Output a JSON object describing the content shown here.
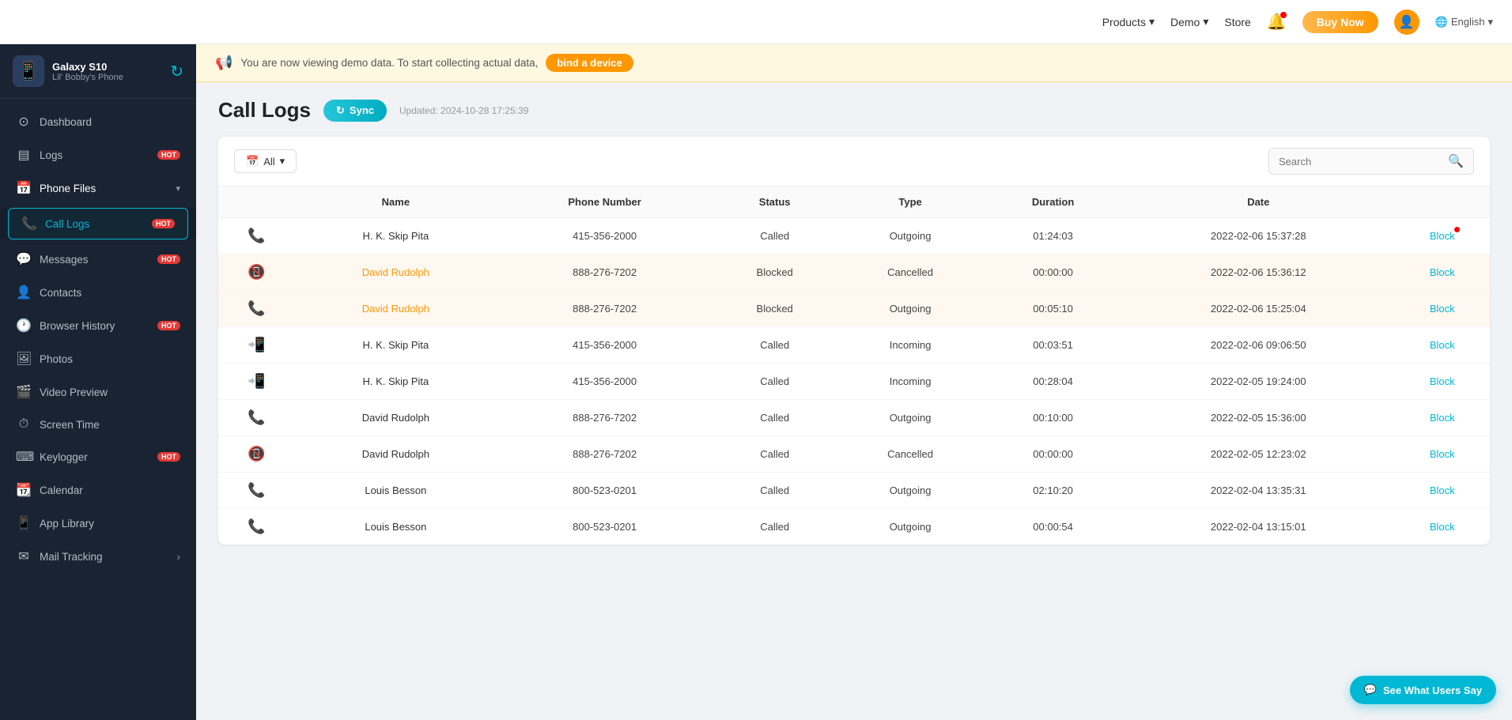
{
  "topnav": {
    "products_label": "Products",
    "demo_label": "Demo",
    "store_label": "Store",
    "buy_now_label": "Buy Now",
    "english_label": "English",
    "chevron": "▾"
  },
  "sidebar": {
    "device_name": "Galaxy S10",
    "device_sub": "Lil' Bobby's Phone",
    "items": [
      {
        "id": "dashboard",
        "label": "Dashboard",
        "icon": "⊙"
      },
      {
        "id": "logs",
        "label": "Logs",
        "icon": "▤",
        "hot": true
      },
      {
        "id": "phone-files",
        "label": "Phone Files",
        "icon": "📅",
        "has_chevron": true,
        "expanded": true
      },
      {
        "id": "call-logs",
        "label": "Call Logs",
        "icon": "📞",
        "hot": true,
        "sub": true,
        "selected": true
      },
      {
        "id": "messages",
        "label": "Messages",
        "icon": "💬",
        "hot": true,
        "sub": false
      },
      {
        "id": "contacts",
        "label": "Contacts",
        "icon": "👤"
      },
      {
        "id": "browser-history",
        "label": "Browser History",
        "icon": "🕐",
        "hot": true
      },
      {
        "id": "photos",
        "label": "Photos",
        "icon": "🖼"
      },
      {
        "id": "video-preview",
        "label": "Video Preview",
        "icon": "🎬"
      },
      {
        "id": "screen-time",
        "label": "Screen Time",
        "icon": "⏱"
      },
      {
        "id": "keylogger",
        "label": "Keylogger",
        "icon": "⌨",
        "hot": true
      },
      {
        "id": "calendar",
        "label": "Calendar",
        "icon": "📆"
      },
      {
        "id": "app-library",
        "label": "App Library",
        "icon": "📱"
      },
      {
        "id": "mail-tracking",
        "label": "Mail Tracking",
        "icon": "✉",
        "has_arrow": true
      }
    ]
  },
  "banner": {
    "text": "You are now viewing demo data. To start collecting actual data,",
    "bind_btn_label": "bind a device"
  },
  "page": {
    "title": "Call Logs",
    "sync_label": "Sync",
    "updated_text": "Updated: 2024-10-28 17:25:39",
    "filter_label": "All",
    "search_placeholder": "Search",
    "columns": [
      "Name",
      "Phone Number",
      "Status",
      "Type",
      "Duration",
      "Date"
    ],
    "rows": [
      {
        "name": "H. K. Skip Pita",
        "phone": "415-356-2000",
        "status": "Called",
        "type": "Outgoing",
        "duration": "01:24:03",
        "date": "2022-02-06 15:37:28",
        "highlighted": false,
        "name_type": "plain",
        "call_icon": "out"
      },
      {
        "name": "David Rudolph",
        "phone": "888-276-7202",
        "status": "Blocked",
        "type": "Cancelled",
        "duration": "00:00:00",
        "date": "2022-02-06 15:36:12",
        "highlighted": true,
        "name_type": "link",
        "call_icon": "cancelled"
      },
      {
        "name": "David Rudolph",
        "phone": "888-276-7202",
        "status": "Blocked",
        "type": "Outgoing",
        "duration": "00:05:10",
        "date": "2022-02-06 15:25:04",
        "highlighted": true,
        "name_type": "link",
        "call_icon": "out"
      },
      {
        "name": "H. K. Skip Pita",
        "phone": "415-356-2000",
        "status": "Called",
        "type": "Incoming",
        "duration": "00:03:51",
        "date": "2022-02-06 09:06:50",
        "highlighted": false,
        "name_type": "plain",
        "call_icon": "in"
      },
      {
        "name": "H. K. Skip Pita",
        "phone": "415-356-2000",
        "status": "Called",
        "type": "Incoming",
        "duration": "00:28:04",
        "date": "2022-02-05 19:24:00",
        "highlighted": false,
        "name_type": "plain",
        "call_icon": "in"
      },
      {
        "name": "David Rudolph",
        "phone": "888-276-7202",
        "status": "Called",
        "type": "Outgoing",
        "duration": "00:10:00",
        "date": "2022-02-05 15:36:00",
        "highlighted": false,
        "name_type": "plain",
        "call_icon": "out"
      },
      {
        "name": "David Rudolph",
        "phone": "888-276-7202",
        "status": "Called",
        "type": "Cancelled",
        "duration": "00:00:00",
        "date": "2022-02-05 12:23:02",
        "highlighted": false,
        "name_type": "plain",
        "call_icon": "cancelled"
      },
      {
        "name": "Louis Besson",
        "phone": "800-523-0201",
        "status": "Called",
        "type": "Outgoing",
        "duration": "02:10:20",
        "date": "2022-02-04 13:35:31",
        "highlighted": false,
        "name_type": "plain",
        "call_icon": "out"
      },
      {
        "name": "Louis Besson",
        "phone": "800-523-0201",
        "status": "Called",
        "type": "Outgoing",
        "duration": "00:00:54",
        "date": "2022-02-04 13:15:01",
        "highlighted": false,
        "name_type": "plain",
        "call_icon": "out"
      }
    ],
    "block_label": "Block",
    "chat_bubble_label": "See What Users Say"
  },
  "colors": {
    "accent": "#00b8d4",
    "hot_badge": "#e53935",
    "highlight_row": "#fff8f0",
    "orange": "#ff9800"
  }
}
